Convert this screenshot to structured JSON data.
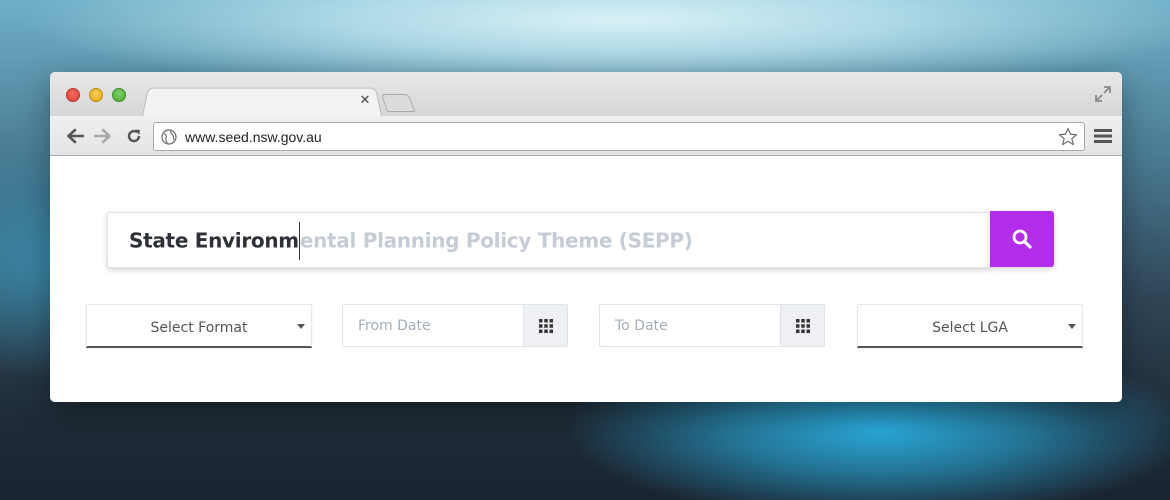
{
  "browser": {
    "url": "www.seed.nsw.gov.au",
    "tab_close_glyph": "✕"
  },
  "search": {
    "typed_text": "State Environm",
    "suggestion_text": "ental Planning Policy Theme (SEPP)",
    "button_icon": "search-icon",
    "accent_color": "#b22cea"
  },
  "filters": {
    "format": {
      "label": "Select Format"
    },
    "from_date": {
      "placeholder": "From Date",
      "icon": "calendar-grid-icon"
    },
    "to_date": {
      "placeholder": "To Date",
      "icon": "calendar-grid-icon"
    },
    "lga": {
      "label": "Select LGA"
    }
  }
}
